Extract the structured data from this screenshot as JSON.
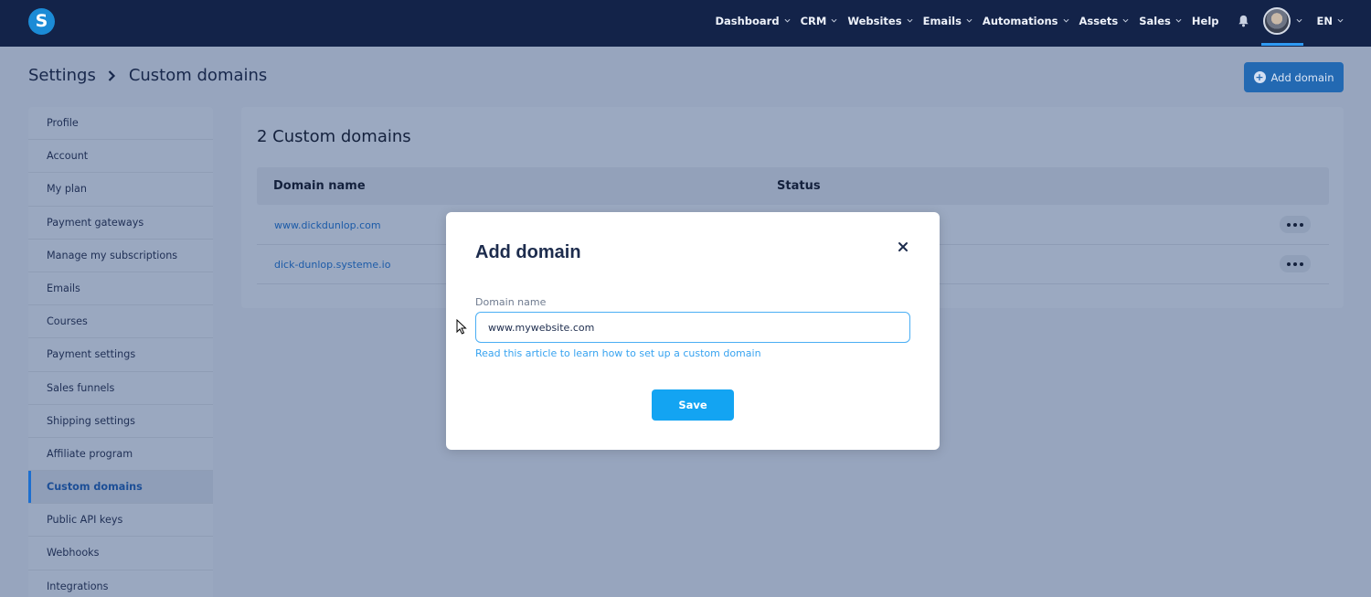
{
  "app": {
    "logo_letter": "S"
  },
  "nav": {
    "items": [
      {
        "label": "Dashboard",
        "has_dropdown": true
      },
      {
        "label": "CRM",
        "has_dropdown": true
      },
      {
        "label": "Websites",
        "has_dropdown": true
      },
      {
        "label": "Emails",
        "has_dropdown": true
      },
      {
        "label": "Automations",
        "has_dropdown": true
      },
      {
        "label": "Assets",
        "has_dropdown": true
      },
      {
        "label": "Sales",
        "has_dropdown": true
      },
      {
        "label": "Help",
        "has_dropdown": false
      }
    ],
    "notifications_icon": "bell-icon",
    "language": "EN"
  },
  "header": {
    "breadcrumb": [
      "Settings",
      "Custom domains"
    ],
    "add_domain_label": "Add domain"
  },
  "sidebar": {
    "items": [
      {
        "label": "Profile"
      },
      {
        "label": "Account"
      },
      {
        "label": "My plan"
      },
      {
        "label": "Payment gateways"
      },
      {
        "label": "Manage my subscriptions"
      },
      {
        "label": "Emails"
      },
      {
        "label": "Courses"
      },
      {
        "label": "Payment settings"
      },
      {
        "label": "Sales funnels"
      },
      {
        "label": "Shipping settings"
      },
      {
        "label": "Affiliate program"
      },
      {
        "label": "Custom domains",
        "active": true
      },
      {
        "label": "Public API keys"
      },
      {
        "label": "Webhooks"
      },
      {
        "label": "Integrations"
      }
    ]
  },
  "domains": {
    "title": "2 Custom domains",
    "columns": [
      "Domain name",
      "Status"
    ],
    "rows": [
      {
        "domain": "www.dickdunlop.com"
      },
      {
        "domain": "dick-dunlop.systeme.io"
      }
    ]
  },
  "modal": {
    "title": "Add domain",
    "field_label": "Domain name",
    "field_value": "www.mywebsite.com",
    "help_link": "Read this article to learn how to set up a custom domain",
    "save_label": "Save"
  },
  "colors": {
    "nav_bg": "#132349",
    "accent": "#13a4f2",
    "link": "#37a3f0",
    "overlay_bg": "#97a5be"
  }
}
